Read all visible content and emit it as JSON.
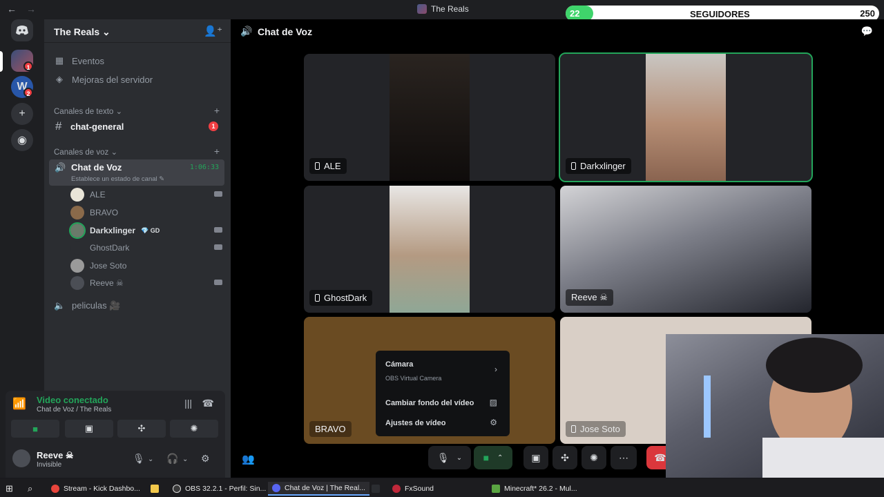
{
  "titlebar": {
    "title": "The Reals"
  },
  "overlay": {
    "current": "22",
    "label": "SEGUIDORES",
    "max": "250",
    "progress": 0.088
  },
  "guilds": {
    "badges": [
      "1",
      "2"
    ]
  },
  "server": {
    "name": "The Reals ⌄"
  },
  "sidebar": {
    "events": "Eventos",
    "boosts": "Mejoras del servidor",
    "text_category": "Canales de texto ⌄",
    "general_channel": "chat-general",
    "general_unread": "1",
    "voice_category": "Canales de voz ⌄",
    "voice_channel": "Chat de Voz",
    "voice_timer": "1:06:33",
    "voice_status": "Establece un estado de canal ✎",
    "voice_users": [
      "ALE",
      "BRAVO",
      "Darkxlinger",
      "GhostDark",
      "Jose Soto",
      "Reeve ☠"
    ],
    "darkx_tag": "💎 GD",
    "peliculas": "peliculas 🎥"
  },
  "connection": {
    "title": "Video conectado",
    "sub": "Chat de Voz / The Reals"
  },
  "user": {
    "name": "Reeve ☠",
    "status": "Invisible"
  },
  "main": {
    "channel": "Chat de Voz"
  },
  "tiles": {
    "ale": "ALE",
    "darkx": "Darkxlinger",
    "ghost": "GhostDark",
    "reeve": "Reeve ☠",
    "bravo": "BRAVO",
    "jose": "Jose Soto"
  },
  "menu": {
    "camera": "Cámara",
    "camera_sub": "OBS Virtual Camera",
    "background": "Cambiar fondo del vídeo",
    "video_settings": "Ajustes de vídeo"
  },
  "taskbar": {
    "items": [
      "Stream - Kick Dashbo...",
      "OBS 32.2.1 - Perfil: Sin...",
      "Chat de Voz | The Real...",
      "FxSound",
      "Minecraft* 26.2 - Mul..."
    ]
  },
  "colors": {
    "accent_green": "#23a55a",
    "danger": "#f23f43",
    "bg_sidebar": "#2b2d31",
    "bg_main": "#000000"
  }
}
